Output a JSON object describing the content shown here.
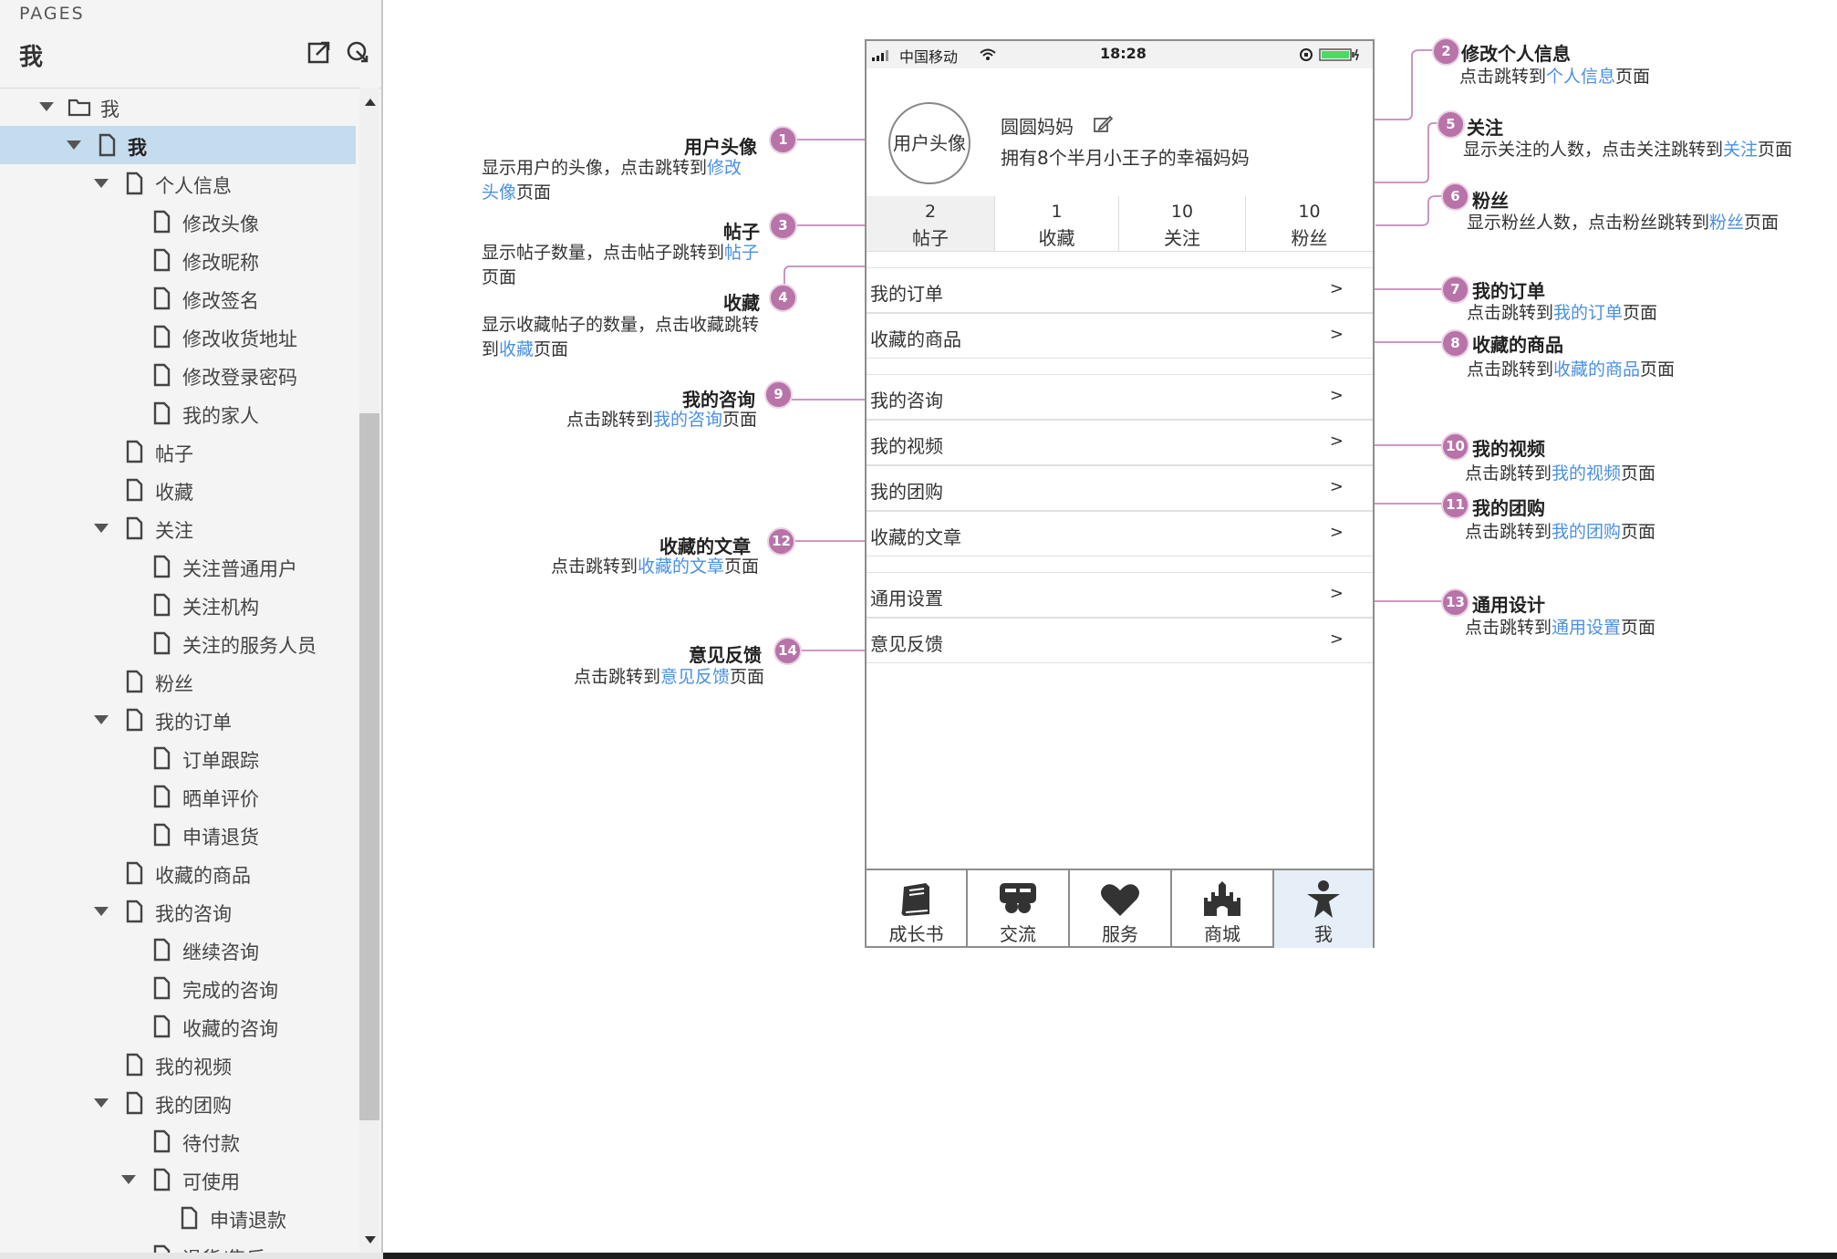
{
  "sidebar": {
    "caption": "PAGES",
    "title": "我",
    "tree": [
      {
        "label": "我",
        "type": "folder",
        "depth": 0,
        "expanded": true
      },
      {
        "label": "我",
        "type": "page",
        "depth": 1,
        "expanded": true,
        "selected": true
      },
      {
        "label": "个人信息",
        "type": "page",
        "depth": 2,
        "expanded": true
      },
      {
        "label": "修改头像",
        "type": "page",
        "depth": 3
      },
      {
        "label": "修改昵称",
        "type": "page",
        "depth": 3
      },
      {
        "label": "修改签名",
        "type": "page",
        "depth": 3
      },
      {
        "label": "修改收货地址",
        "type": "page",
        "depth": 3
      },
      {
        "label": "修改登录密码",
        "type": "page",
        "depth": 3
      },
      {
        "label": "我的家人",
        "type": "page",
        "depth": 3
      },
      {
        "label": "帖子",
        "type": "page",
        "depth": 2
      },
      {
        "label": "收藏",
        "type": "page",
        "depth": 2
      },
      {
        "label": "关注",
        "type": "page",
        "depth": 2,
        "expanded": true
      },
      {
        "label": "关注普通用户",
        "type": "page",
        "depth": 3
      },
      {
        "label": "关注机构",
        "type": "page",
        "depth": 3
      },
      {
        "label": "关注的服务人员",
        "type": "page",
        "depth": 3
      },
      {
        "label": "粉丝",
        "type": "page",
        "depth": 2
      },
      {
        "label": "我的订单",
        "type": "page",
        "depth": 2,
        "expanded": true
      },
      {
        "label": "订单跟踪",
        "type": "page",
        "depth": 3
      },
      {
        "label": "晒单评价",
        "type": "page",
        "depth": 3
      },
      {
        "label": "申请退货",
        "type": "page",
        "depth": 3
      },
      {
        "label": "收藏的商品",
        "type": "page",
        "depth": 2
      },
      {
        "label": "我的咨询",
        "type": "page",
        "depth": 2,
        "expanded": true
      },
      {
        "label": "继续咨询",
        "type": "page",
        "depth": 3
      },
      {
        "label": "完成的咨询",
        "type": "page",
        "depth": 3
      },
      {
        "label": "收藏的咨询",
        "type": "page",
        "depth": 3
      },
      {
        "label": "我的视频",
        "type": "page",
        "depth": 2
      },
      {
        "label": "我的团购",
        "type": "page",
        "depth": 2,
        "expanded": true
      },
      {
        "label": "待付款",
        "type": "page",
        "depth": 3
      },
      {
        "label": "可使用",
        "type": "page",
        "depth": 3,
        "expanded": true
      },
      {
        "label": "申请退款",
        "type": "page",
        "depth": 4
      },
      {
        "label": "退货/售后",
        "type": "page",
        "depth": 3
      }
    ]
  },
  "phone": {
    "status": {
      "carrier": "中国移动",
      "time": "18:28"
    },
    "profile": {
      "avatar_label": "用户头像",
      "nickname": "圆圆妈妈",
      "signature": "拥有8个半月小王子的幸福妈妈"
    },
    "stats": [
      {
        "num": "2",
        "label": "帖子"
      },
      {
        "num": "1",
        "label": "收藏"
      },
      {
        "num": "10",
        "label": "关注"
      },
      {
        "num": "10",
        "label": "粉丝"
      }
    ],
    "menu": [
      {
        "label": "我的订单",
        "arrow": ">"
      },
      {
        "label": "收藏的商品",
        "arrow": ">"
      },
      {
        "label": "我的咨询",
        "arrow": ">"
      },
      {
        "label": "我的视频",
        "arrow": ">"
      },
      {
        "label": "我的团购",
        "arrow": ">"
      },
      {
        "label": "收藏的文章",
        "arrow": ">"
      },
      {
        "label": "通用设置",
        "arrow": ">"
      },
      {
        "label": "意见反馈",
        "arrow": ">"
      }
    ],
    "tabs": [
      {
        "label": "成长书",
        "icon": "book-icon"
      },
      {
        "label": "交流",
        "icon": "chat-icon"
      },
      {
        "label": "服务",
        "icon": "heart-icon"
      },
      {
        "label": "商城",
        "icon": "castle-icon"
      },
      {
        "label": "我",
        "icon": "person-icon",
        "active": true
      }
    ]
  },
  "annotations": {
    "a1": {
      "num": "1",
      "title": "用户头像",
      "desc1": "显示用户的头像，点击跳转到",
      "link1": "修改",
      "link2": "头像",
      "tail": "页面"
    },
    "a2": {
      "num": "2",
      "title": "修改个人信息",
      "pre": "点击跳转到",
      "link": "个人信息",
      "tail": "页面"
    },
    "a3": {
      "num": "3",
      "title": "帖子",
      "pre": "显示帖子数量，点击帖子跳转到",
      "link": "帖子",
      "tail": "页面"
    },
    "a4": {
      "num": "4",
      "title": "收藏",
      "pre": "显示收藏帖子的数量，点击收藏跳转",
      "pre2": "到",
      "link": "收藏",
      "tail": "页面"
    },
    "a5": {
      "num": "5",
      "title": "关注",
      "pre": "显示关注的人数，点击关注跳转到",
      "link": "关注",
      "tail": "页面"
    },
    "a6": {
      "num": "6",
      "title": "粉丝",
      "pre": "显示粉丝人数，点击粉丝跳转到",
      "link": "粉丝",
      "tail": "页面"
    },
    "a7": {
      "num": "7",
      "title": "我的订单",
      "pre": "点击跳转到",
      "link": "我的订单",
      "tail": "页面"
    },
    "a8": {
      "num": "8",
      "title": "收藏的商品",
      "pre": "点击跳转到",
      "link": "收藏的商品",
      "tail": "页面"
    },
    "a9": {
      "num": "9",
      "title": "我的咨询",
      "pre": "点击跳转到",
      "link": "我的咨询",
      "tail": "页面"
    },
    "a10": {
      "num": "10",
      "title": "我的视频",
      "pre": "点击跳转到",
      "link": "我的视频",
      "tail": "页面"
    },
    "a11": {
      "num": "11",
      "title": "我的团购",
      "pre": "点击跳转到",
      "link": "我的团购",
      "tail": "页面"
    },
    "a12": {
      "num": "12",
      "title": "收藏的文章",
      "pre": "点击跳转到",
      "link": "收藏的文章",
      "tail": "页面"
    },
    "a13": {
      "num": "13",
      "title": "通用设计",
      "pre": "点击跳转到",
      "link": "通用设置",
      "tail": "页面"
    },
    "a14": {
      "num": "14",
      "title": "意见反馈",
      "pre": "点击跳转到",
      "link": "意见反馈",
      "tail": "页面"
    }
  },
  "colors": {
    "badge": "#b873a8",
    "link": "#4a90e2",
    "selected_row": "#c5dcef",
    "connector": "#c58abb"
  }
}
